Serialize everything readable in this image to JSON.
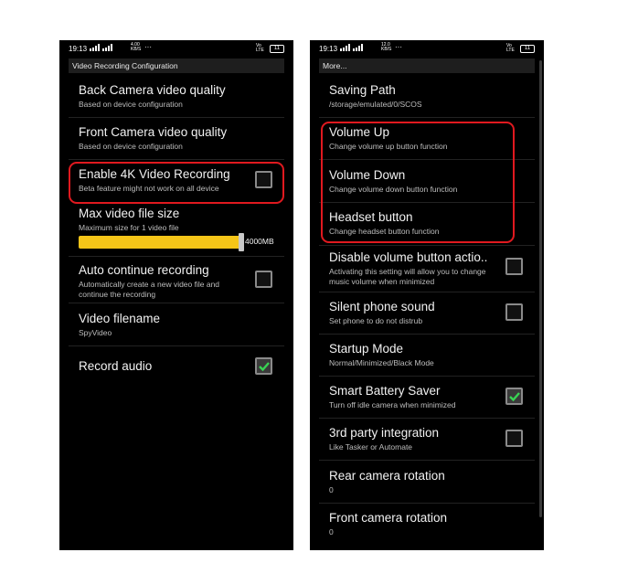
{
  "left": {
    "status": {
      "time": "19:13",
      "net_speed": "4.00 KB/S",
      "dots": "···",
      "volte": "Vo LTE",
      "battery": "11"
    },
    "header": "Video Recording Configuration",
    "items": [
      {
        "title": "Back Camera video quality",
        "sub": "Based on device configuration"
      },
      {
        "title": "Front Camera video quality",
        "sub": "Based on device configuration"
      },
      {
        "title": "Enable 4K Video Recording",
        "sub": "Beta feature might not work on all device",
        "checked": false
      },
      {
        "title": "Max video file size",
        "sub": "Maximum size for 1 video file",
        "slider_label": "4000MB",
        "slider_fraction": 0.97
      },
      {
        "title": "Auto continue recording",
        "sub": "Automatically create a new video file and continue the recording",
        "checked": false
      },
      {
        "title": "Video filename",
        "sub": "SpyVideo"
      },
      {
        "title": "Record audio",
        "checked": true
      }
    ]
  },
  "right": {
    "status": {
      "time": "19:13",
      "net_speed": "12.0 KB/S",
      "dots": "···",
      "volte": "Vo LTE",
      "battery": "11"
    },
    "header": "More...",
    "items": [
      {
        "title": "Saving Path",
        "sub": "/storage/emulated/0/SCOS"
      },
      {
        "title": "Volume Up",
        "sub": "Change volume up button function"
      },
      {
        "title": "Volume Down",
        "sub": "Change volume down button function"
      },
      {
        "title": "Headset button",
        "sub": "Change headset button function"
      },
      {
        "title": "Disable volume button actio..",
        "sub": "Activating this setting will allow you to change music volume when minimized",
        "checked": false
      },
      {
        "title": "Silent phone sound",
        "sub": "Set phone to do not distrub",
        "checked": false
      },
      {
        "title": "Startup Mode",
        "sub": "Normal/Minimized/Black Mode"
      },
      {
        "title": "Smart Battery Saver",
        "sub": "Turn off idle camera when minimized",
        "checked": true
      },
      {
        "title": "3rd party integration",
        "sub": "Like Tasker or Automate",
        "checked": false
      },
      {
        "title": "Rear camera rotation",
        "sub": "0"
      },
      {
        "title": "Front camera rotation",
        "sub": "0"
      }
    ]
  },
  "colors": {
    "highlight": "#e0191f",
    "slider": "#f5c518",
    "check": "#39d353"
  }
}
